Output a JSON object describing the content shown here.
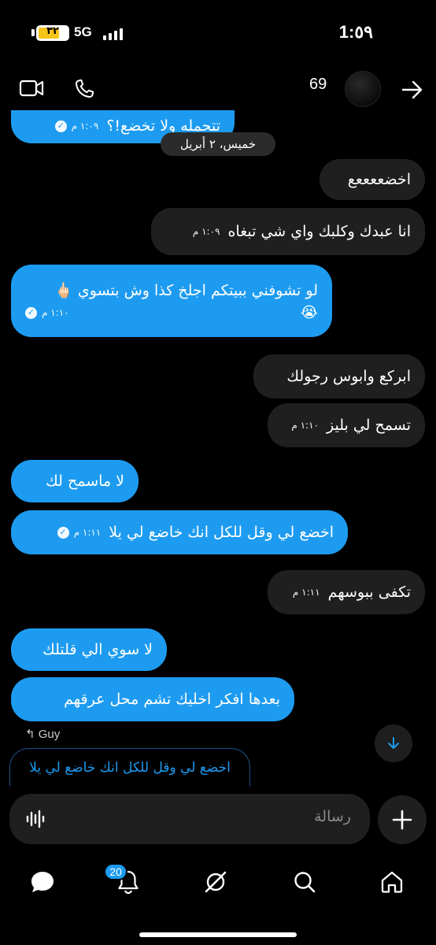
{
  "status_bar": {
    "battery_level": "٣٢",
    "network": "5G",
    "time": "1:٥٩"
  },
  "header": {
    "contact_name": "69",
    "icons": [
      "back-arrow-icon",
      "video-call-icon",
      "phone-call-icon"
    ]
  },
  "chat": {
    "date_separator": "خميس، ٢ أبريل",
    "messages": [
      {
        "sender": "me",
        "text": "تتحمله ولا تخضع!؟",
        "time": "١:٠٩ م",
        "read": true
      },
      {
        "sender": "them",
        "text": "اخضععععع",
        "time": ""
      },
      {
        "sender": "them",
        "text": "انا عبدك وكلبك واي شي تبغاه",
        "time": "١:٠٩ م"
      },
      {
        "sender": "me",
        "text": "لو تشوفني ببيتكم اجلخ كذا وش بتسوي 🖕🏻",
        "text2": "😭",
        "time": "١:١٠ م",
        "read": true
      },
      {
        "sender": "them",
        "text": "ابركع وابوس رجولك",
        "time": ""
      },
      {
        "sender": "them",
        "text": "تسمح لي بليز",
        "time": "١:١٠ م"
      },
      {
        "sender": "me",
        "text": "لا ماسمح لك",
        "time": ""
      },
      {
        "sender": "me",
        "text": "اخضع لي وقل للكل انك خاضع لي يلا",
        "time": "١:١١ م",
        "read": true
      },
      {
        "sender": "them",
        "text": "تكفى ببوسهم",
        "time": "١:١١ م"
      },
      {
        "sender": "me",
        "text": "لا سوي الي قلتلك",
        "time": ""
      },
      {
        "sender": "me",
        "text": "بعدها افكر اخليك تشم محل عرقهم",
        "time": ""
      }
    ],
    "reply_to_name": "Guy",
    "reply_quote": "اخضع لي وقل للكل انك خاضع لي يلا"
  },
  "composer": {
    "placeholder": "رسالة"
  },
  "tabbar": {
    "notification_count": "20",
    "items": [
      "messages-icon",
      "notifications-icon",
      "grok-icon",
      "search-icon",
      "home-icon"
    ]
  },
  "colors": {
    "accent": "#1d9bf0",
    "received_bubble": "#1f1f1f",
    "background": "#000000"
  }
}
